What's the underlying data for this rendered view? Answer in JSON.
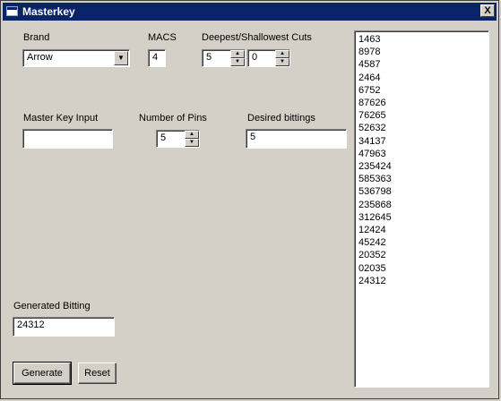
{
  "window": {
    "title": "Masterkey",
    "close_label": "X"
  },
  "brand": {
    "label": "Brand",
    "value": "Arrow"
  },
  "macs": {
    "label": "MACS",
    "value": "4"
  },
  "cuts": {
    "label": "Deepest/Shallowest Cuts",
    "deepest": "5",
    "shallowest": "0"
  },
  "master_key": {
    "label": "Master Key Input",
    "value": ""
  },
  "pins": {
    "label": "Number of Pins",
    "value": "5"
  },
  "bittings": {
    "label": "Desired bittings",
    "value": "5"
  },
  "generated": {
    "label": "Generated Bitting",
    "value": "24312"
  },
  "buttons": {
    "generate": "Generate",
    "reset": "Reset"
  },
  "results": [
    "1463",
    "8978",
    "4587",
    "2464",
    "6752",
    "87626",
    "76265",
    "52632",
    "34137",
    "47963",
    "235424",
    "585363",
    "536798",
    "235868",
    "312645",
    "12424",
    "45242",
    "20352",
    "02035",
    "24312"
  ]
}
